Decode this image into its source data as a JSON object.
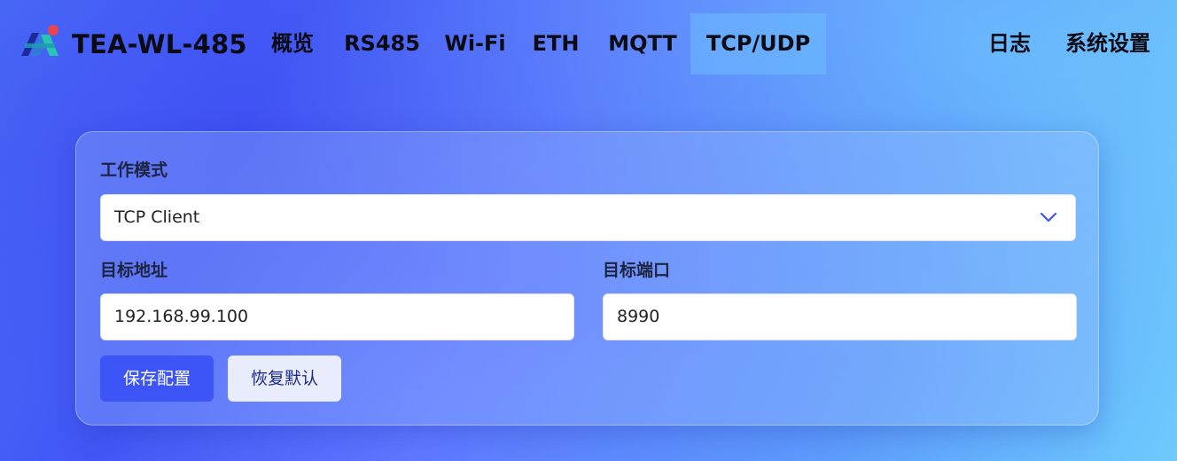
{
  "header": {
    "brand": "TEA-WL-485",
    "nav": [
      {
        "label": "概览"
      },
      {
        "label": "RS485"
      },
      {
        "label": "Wi-Fi"
      },
      {
        "label": "ETH"
      },
      {
        "label": "MQTT"
      },
      {
        "label": "TCP/UDP",
        "active": true
      }
    ],
    "right_nav": [
      {
        "label": "日志"
      },
      {
        "label": "系统设置"
      }
    ]
  },
  "form": {
    "mode_label": "工作模式",
    "mode_value": "TCP Client",
    "address_label": "目标地址",
    "address_value": "192.168.99.100",
    "port_label": "目标端口",
    "port_value": "8990",
    "save_label": "保存配置",
    "reset_label": "恢复默认"
  },
  "colors": {
    "accent": "#3d55f7",
    "logo_dot": "#e8434f",
    "logo_teal": "#26c6b0"
  },
  "icons": {
    "logo": "brand-logo-icon",
    "select": "chevron-down-icon"
  }
}
